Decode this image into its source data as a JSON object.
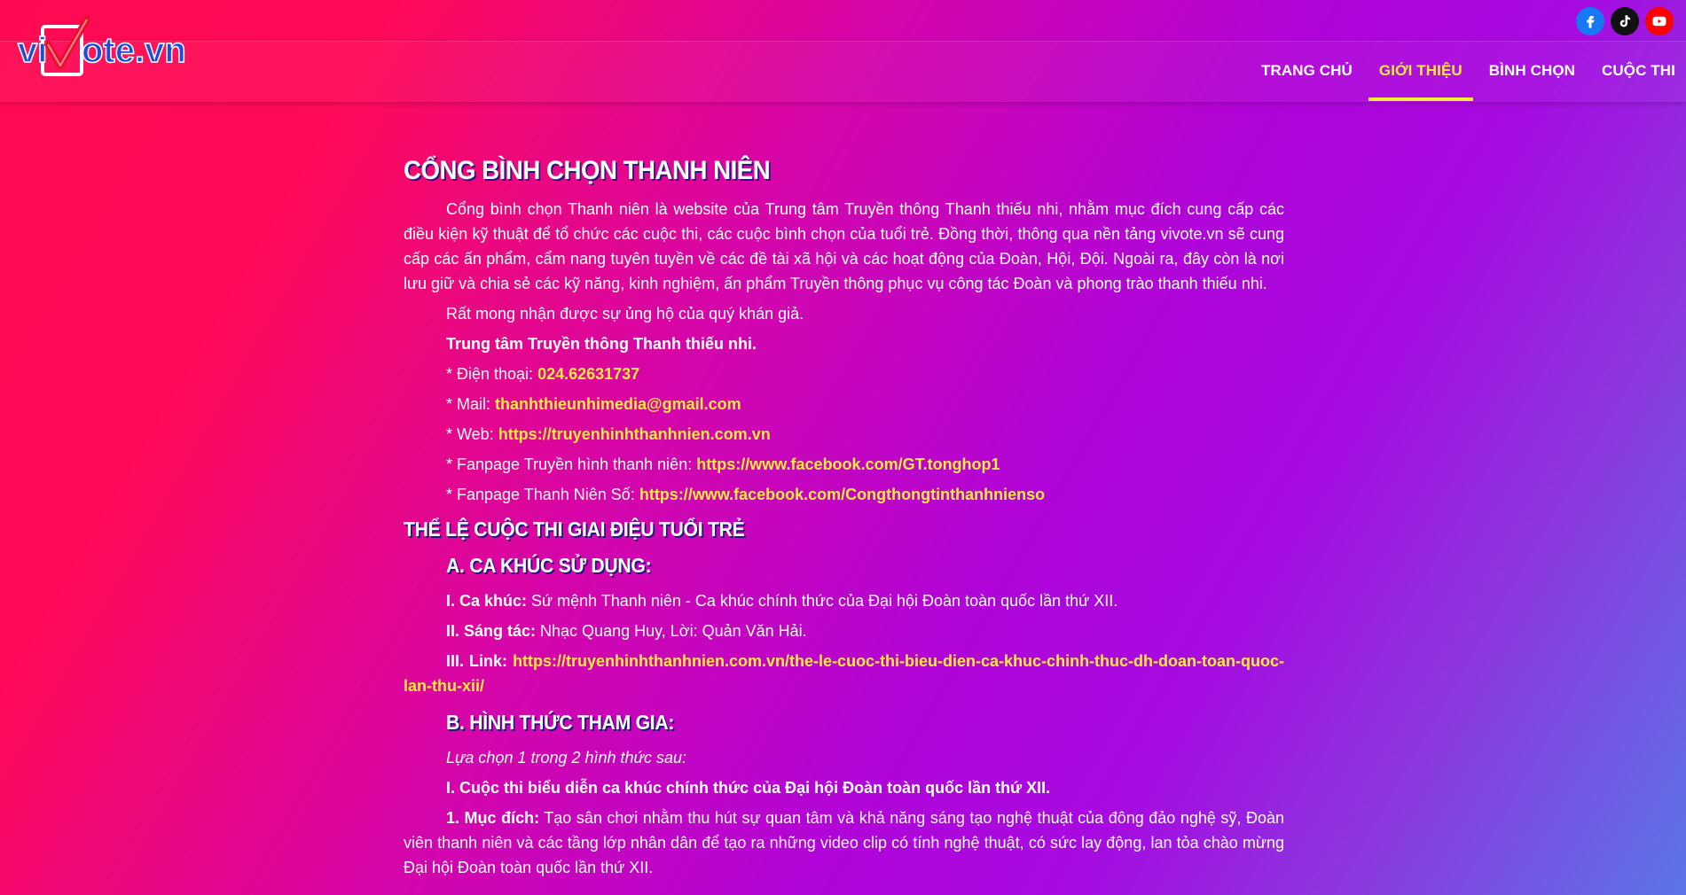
{
  "brand": {
    "logo_text": "vivote.vn"
  },
  "social": [
    {
      "name": "facebook",
      "icon": "facebook-icon",
      "color": "#1877f2"
    },
    {
      "name": "tiktok",
      "icon": "tiktok-icon",
      "color": "#111111"
    },
    {
      "name": "youtube",
      "icon": "youtube-icon",
      "color": "#ff0000"
    }
  ],
  "nav": {
    "home": "TRANG CHỦ",
    "about": "GIỚI THIỆU",
    "vote": "BÌNH CHỌN",
    "contest": "CUỘC THI",
    "active": "about"
  },
  "content": {
    "title": "CỔNG BÌNH CHỌN THANH NIÊN",
    "intro": "Cổng bình chọn Thanh niên là website của Trung tâm Truyền thông Thanh thiếu nhi, nhằm mục đích cung cấp các điều kiện kỹ thuật để tổ chức các cuộc thi, các cuộc bình chọn của tuổi trẻ. Đồng thời, thông qua nền tảng vivote.vn sẽ cung cấp các ấn phẩm, cẩm nang tuyên tuyền về các đề tài xã hội và các hoạt động của Đoàn, Hội, Đội. Ngoài ra, đây còn là nơi lưu giữ và chia sẻ các kỹ năng, kinh nghiệm, ấn phẩm Truyền thông phục vụ công tác Đoàn và phong trào thanh thiếu nhi.",
    "thanks": "Rất mong nhận được sự ủng hộ của quý khán giả.",
    "org": "Trung tâm Truyền thông Thanh thiếu nhi.",
    "phone_label": "* Điện thoại: ",
    "phone": "024.62631737",
    "mail_label": "* Mail: ",
    "mail": "thanhthieunhimedia@gmail.com",
    "web_label": "* Web: ",
    "web": "https://truyenhinhthanhnien.com.vn",
    "fanpage1_label": "* Fanpage Truyền hình thanh niên: ",
    "fanpage1": "https://www.facebook.com/GT.tonghop1",
    "fanpage2_label": "* Fanpage Thanh Niên Số: ",
    "fanpage2": "https://www.facebook.com/Congthongtinthanhnienso",
    "rules_title": "THỂ LỆ CUỘC THI GIAI ĐIỆU TUỔI TRẺ",
    "section_a": "A. CA KHÚC SỬ DỤNG:",
    "song_label": "I. Ca khúc:",
    "song_text": " Sứ mệnh Thanh niên - Ca khúc chính thức của Đại hội Đoàn toàn quốc lần thứ XII.",
    "composer_label": "II. Sáng tác:",
    "composer_text": " Nhạc Quang Huy, Lời: Quản Văn Hải.",
    "link_label": "III. Link: ",
    "link": "https://truyenhinhthanhnien.com.vn/the-le-cuoc-thi-bieu-dien-ca-khuc-chinh-thuc-dh-doan-toan-quoc-lan-thu-xii/",
    "section_b": "B. HÌNH THỨC THAM GIA:",
    "choose": "Lựa chọn 1 trong 2 hình thức sau:",
    "contest1": "I. Cuộc thi biểu diễn ca khúc chính thức của Đại hội Đoàn toàn quốc lần thứ XII.",
    "purpose_label": "1. Mục đích:",
    "purpose_text": " Tạo sân chơi nhằm thu hút sự quan tâm và khả năng sáng tạo nghệ thuật của đông đảo nghệ sỹ, Đoàn viên thanh niên và các tầng lớp nhân dân để tạo ra những video clip có tính nghệ thuật, có sức lay động, lan tỏa chào mừng Đại hội Đoàn toàn quốc lần thứ XII."
  }
}
